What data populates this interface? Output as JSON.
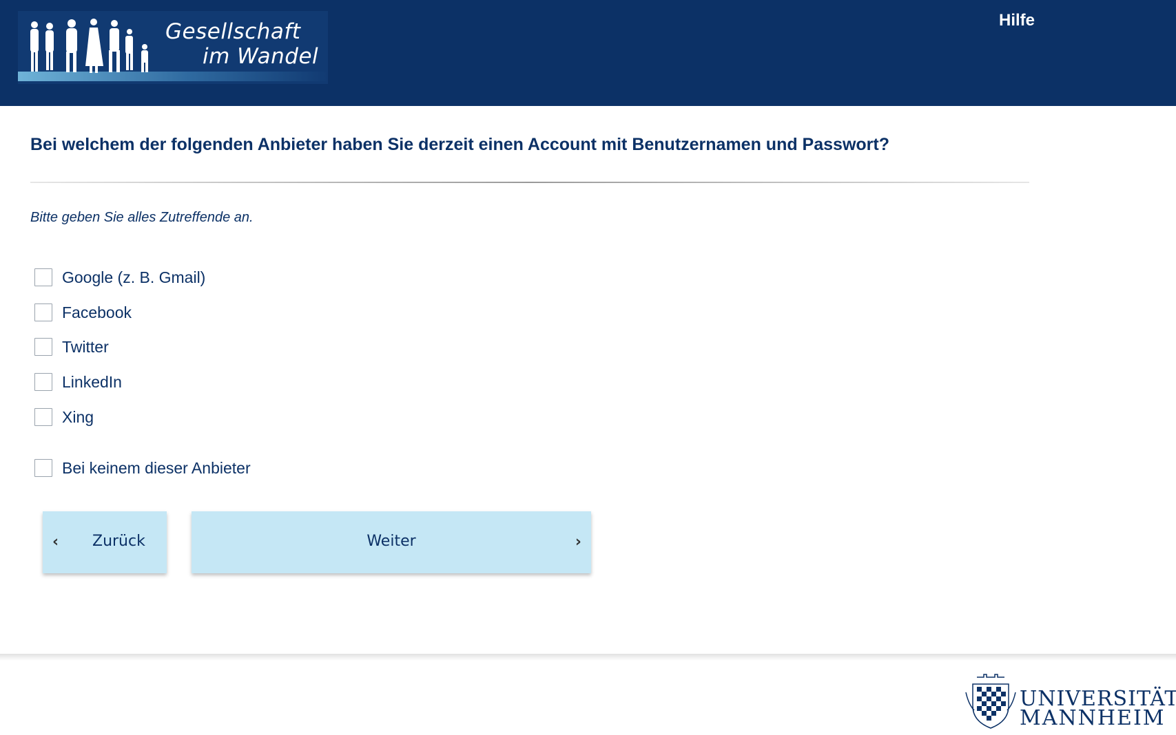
{
  "header": {
    "logo_line1": "Gesellschaft",
    "logo_line2": "im Wandel",
    "help_label": "Hilfe"
  },
  "question": {
    "text": "Bei welchem der folgenden Anbieter haben Sie derzeit einen Account mit Benutzernamen und Passwort?",
    "instruction": "Bitte geben Sie alles Zutreffende an."
  },
  "options": [
    {
      "label": "Google (z. B. Gmail)",
      "checked": false
    },
    {
      "label": "Facebook",
      "checked": false
    },
    {
      "label": "Twitter",
      "checked": false
    },
    {
      "label": "LinkedIn",
      "checked": false
    },
    {
      "label": "Xing",
      "checked": false
    },
    {
      "label": "Bei keinem dieser Anbieter",
      "checked": false
    }
  ],
  "navigation": {
    "back_label": "Zurück",
    "next_label": "Weiter"
  },
  "footer": {
    "university_line1": "UNIVERSITÄT",
    "university_line2": "MANNHEIM"
  },
  "colors": {
    "header_bg": "#0c3166",
    "text_primary": "#0c3166",
    "button_bg": "#c5e7f5"
  },
  "icons": {
    "back": "chevron-left-icon",
    "next": "chevron-right-icon",
    "logo": "people-silhouettes-icon",
    "university": "university-crest-icon"
  }
}
